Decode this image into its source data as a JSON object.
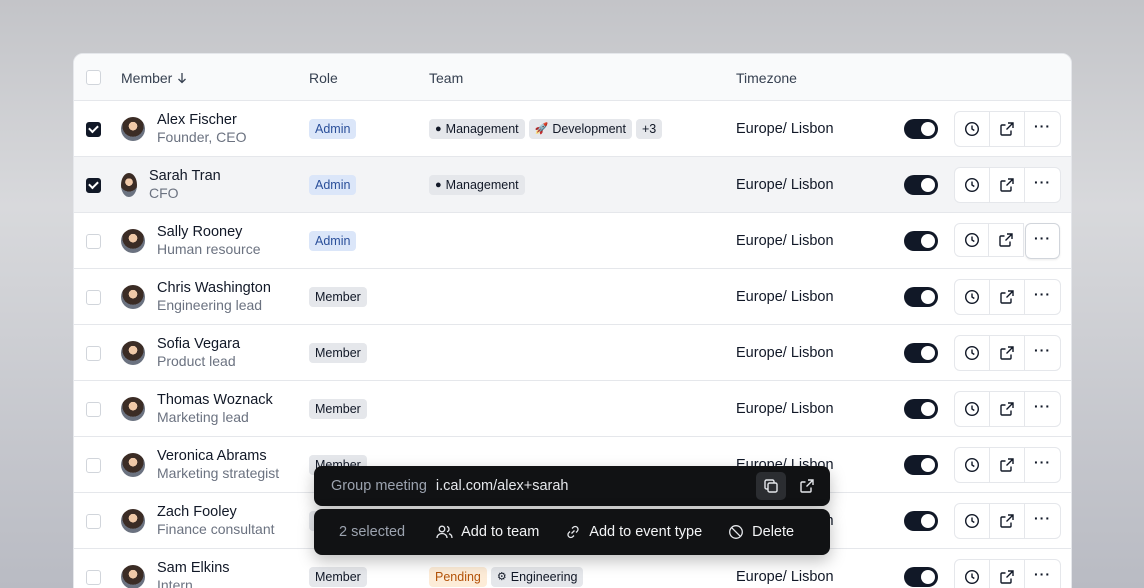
{
  "header": {
    "member": "Member",
    "role": "Role",
    "team": "Team",
    "timezone": "Timezone"
  },
  "rows": [
    {
      "name": "Alex Fischer",
      "title": "Founder, CEO",
      "role": "Admin",
      "role_type": "admin",
      "teams": [
        "Management",
        "Development"
      ],
      "team_icons": [
        "●",
        "🚀"
      ],
      "extra": "+3",
      "timezone": "Europe/ Lisbon",
      "checked": true
    },
    {
      "name": "Sarah Tran",
      "title": "CFO",
      "role": "Admin",
      "role_type": "admin",
      "teams": [
        "Management"
      ],
      "team_icons": [
        "●"
      ],
      "timezone": "Europe/ Lisbon",
      "checked": true
    },
    {
      "name": "Sally Rooney",
      "title": "Human resource",
      "role": "Admin",
      "role_type": "admin",
      "teams": [],
      "timezone": "Europe/ Lisbon",
      "checked": false
    },
    {
      "name": "Chris Washington",
      "title": "Engineering lead",
      "role": "Member",
      "role_type": "member",
      "teams": [],
      "timezone": "Europe/ Lisbon",
      "checked": false
    },
    {
      "name": "Sofia Vegara",
      "title": "Product lead",
      "role": "Member",
      "role_type": "member",
      "teams": [],
      "timezone": "Europe/ Lisbon",
      "checked": false
    },
    {
      "name": "Thomas Woznack",
      "title": "Marketing lead",
      "role": "Member",
      "role_type": "member",
      "teams": [],
      "timezone": "Europe/ Lisbon",
      "checked": false
    },
    {
      "name": "Veronica Abrams",
      "title": "Marketing strategist",
      "role": "Member",
      "role_type": "member",
      "teams": [],
      "timezone": "Europe/ Lisbon",
      "checked": false
    },
    {
      "name": "Zach Fooley",
      "title": "Finance consultant",
      "role": "Member",
      "role_type": "member",
      "teams": [],
      "timezone": "Europe/ Lisbon",
      "checked": false
    },
    {
      "name": "Sam Elkins",
      "title": "Intern",
      "role": "Member",
      "role_type": "member",
      "pending": "Pending",
      "teams": [
        "Engineering"
      ],
      "team_icons": [
        "⚙"
      ],
      "timezone": "Europe/ Lisbon",
      "checked": false
    }
  ],
  "group_bar": {
    "label": "Group meeting",
    "link": "i.cal.com/alex+sarah"
  },
  "action_bar": {
    "selected": "2 selected",
    "add_team": "Add to team",
    "add_event": "Add to event type",
    "delete": "Delete"
  },
  "colors": {
    "accent": "#111827",
    "admin_badge_bg": "#dbe6f9",
    "pending_badge_bg": "#fdecd8"
  }
}
